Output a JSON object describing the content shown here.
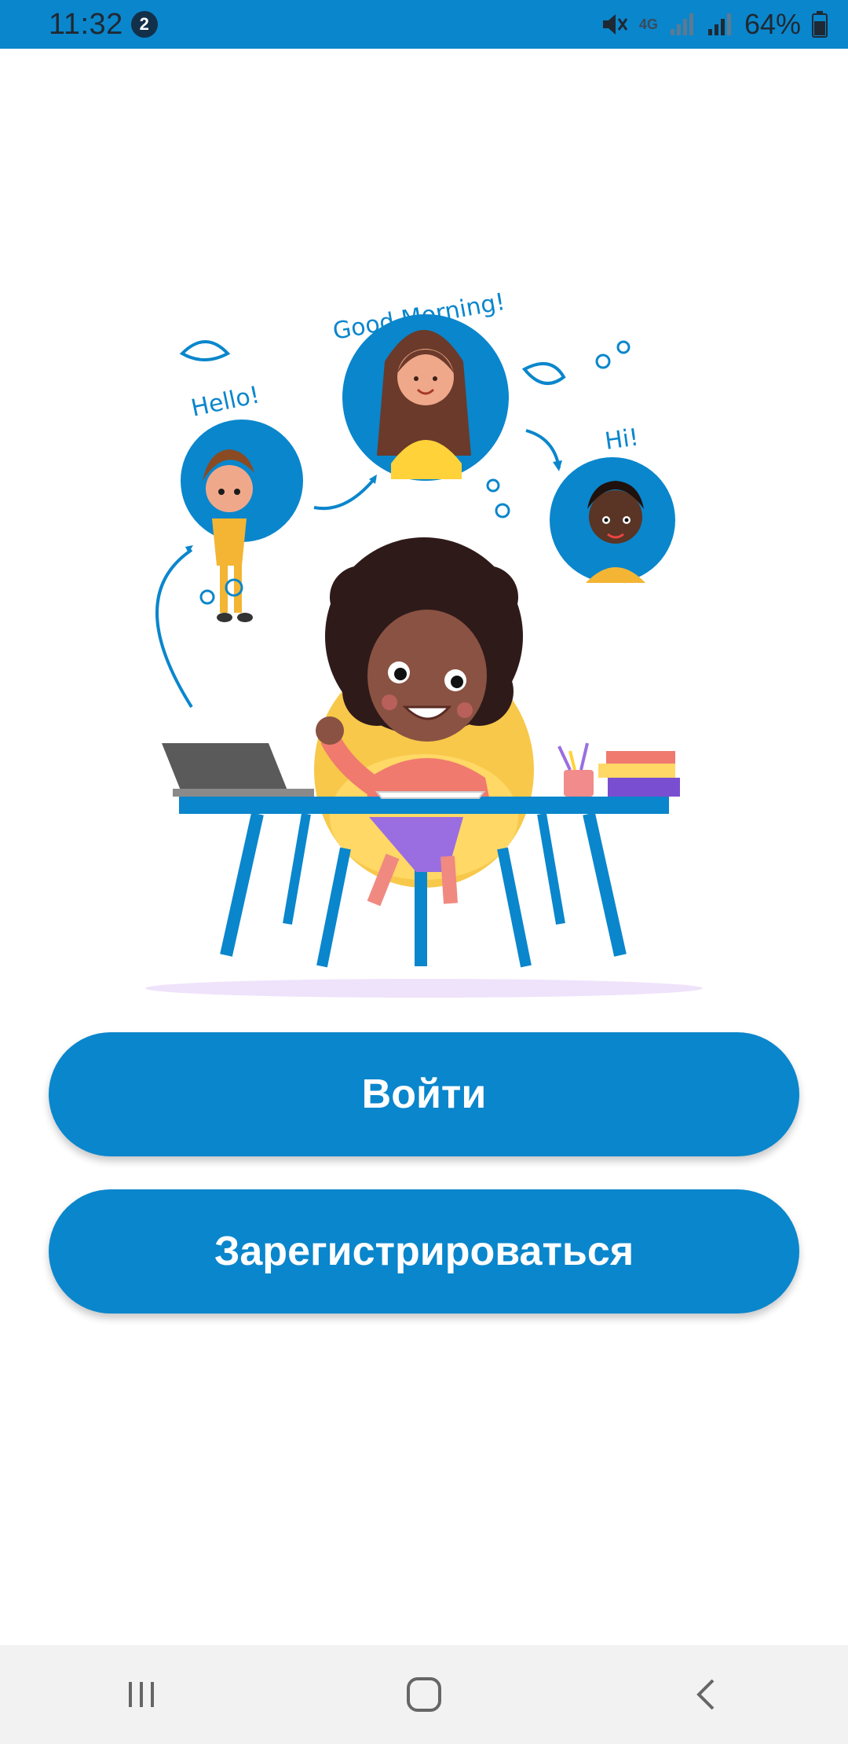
{
  "status_bar": {
    "time": "11:32",
    "notification_count": "2",
    "network": "4G",
    "battery": "64%"
  },
  "illustration": {
    "greeting_left": "Hello!",
    "greeting_top": "Good Morning!",
    "greeting_right": "Hi!"
  },
  "buttons": {
    "login_label": "Войти",
    "register_label": "Зарегистрироваться"
  },
  "nav_bar": {
    "recents_icon": "recents-icon",
    "home_icon": "home-icon",
    "back_icon": "back-icon"
  },
  "colors": {
    "accent": "#0a86cc",
    "status_bar": "#0a86cc",
    "nav_bar": "#f2f2f2"
  }
}
